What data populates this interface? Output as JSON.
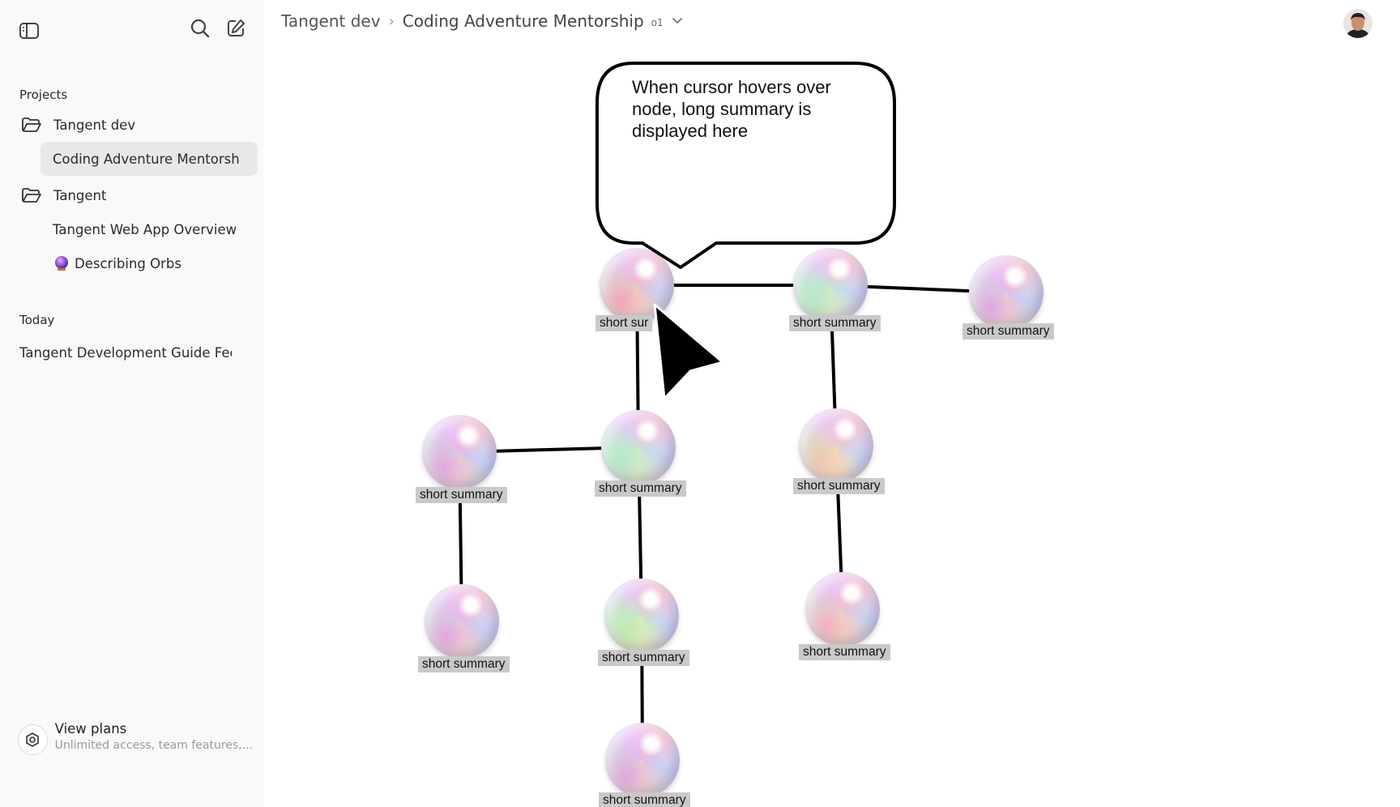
{
  "sidebar": {
    "toggle_icon": "sidebar-toggle-icon",
    "search_icon": "search-icon",
    "new_chat_icon": "compose-icon",
    "projects_label": "Projects",
    "projects": [
      {
        "label": "Tangent dev",
        "icon": "folder-open-icon"
      },
      {
        "label": "Coding Adventure Mentorsh",
        "active": true
      },
      {
        "label": "Tangent",
        "icon": "folder-open-icon"
      },
      {
        "label": "Tangent Web App Overview"
      },
      {
        "label": "Describing Orbs",
        "icon": "orb-icon"
      }
    ],
    "today_label": "Today",
    "today_items": [
      {
        "label": "Tangent Development Guide Fee"
      }
    ],
    "plans": {
      "title": "View plans",
      "subtitle": "Unlimited access, team features,..."
    }
  },
  "header": {
    "breadcrumb_project": "Tangent dev",
    "breadcrumb_chat": "Coding Adventure Mentorship",
    "model_badge": "o1",
    "caret_icon": "chevron-down-icon"
  },
  "canvas": {
    "bubble_text": "When cursor hovers over node, long summary is displayed here",
    "nodes": [
      {
        "label": "short summary",
        "visible_label": "short sur",
        "tint": "#f4a6b8"
      },
      {
        "label": "short summary",
        "tint": "#b8e6c8"
      },
      {
        "label": "short summary",
        "tint": "#e3a6e0"
      },
      {
        "label": "short summary",
        "tint": "#b8e6c8"
      },
      {
        "label": "short summary",
        "tint": "#e3a6e0"
      },
      {
        "label": "short summary",
        "tint": "#f0c6b0"
      },
      {
        "label": "short summary",
        "tint": "#e3a6e0"
      },
      {
        "label": "short summary",
        "tint": "#c0e8b0"
      },
      {
        "label": "short summary",
        "tint": "#f4b0c0"
      },
      {
        "label": "short summary",
        "tint": "#e3a6e0"
      }
    ]
  }
}
